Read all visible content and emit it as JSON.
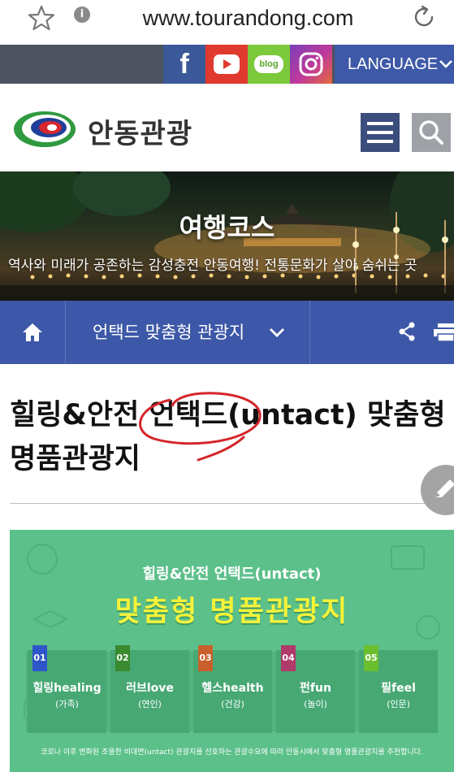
{
  "browser": {
    "url": "www.tourandong.com"
  },
  "socialbar": {
    "facebook_label": "f",
    "blog_label": "blog",
    "language_label": "LANGUAGE",
    "colors": {
      "bar": "#4e5360",
      "facebook": "#3b5998",
      "youtube": "#e03a2f",
      "blog": "#7cc93b",
      "language": "#3e59a8"
    }
  },
  "header": {
    "logo_text": "안동관광"
  },
  "hero": {
    "title": "여행코스",
    "subtitle": "역사와 미래가 공존하는 감성충전 안동여행! 전통문화가 살아 숨쉬는 곳"
  },
  "subnav": {
    "category": "언택드 맞춤형 관광지"
  },
  "page": {
    "title": "힐링&안전 언택드(untact) 맞춤형 명품관광지"
  },
  "banner": {
    "line1": "힐링&안전 언택드(untact)",
    "line2": "맞춤형 명품관광지",
    "panels": [
      {
        "num": "01",
        "name": "힐링healing",
        "sub": "(가족)",
        "badge_color": "#2f56c9"
      },
      {
        "num": "02",
        "name": "러브love",
        "sub": "(연인)",
        "badge_color": "#3a8a2f"
      },
      {
        "num": "03",
        "name": "헬스health",
        "sub": "(건강)",
        "badge_color": "#c9602b"
      },
      {
        "num": "04",
        "name": "펀fun",
        "sub": "(놀이)",
        "badge_color": "#b03a6a"
      },
      {
        "num": "05",
        "name": "필feel",
        "sub": "(인문)",
        "badge_color": "#6bbf2f"
      }
    ],
    "note": "코로나 이후 변화된 조용한 비대면(untact) 관광지를 선호하는 관광수요에 따라 안동시에서 맞춤형 명품관광지를 추천합니다."
  }
}
